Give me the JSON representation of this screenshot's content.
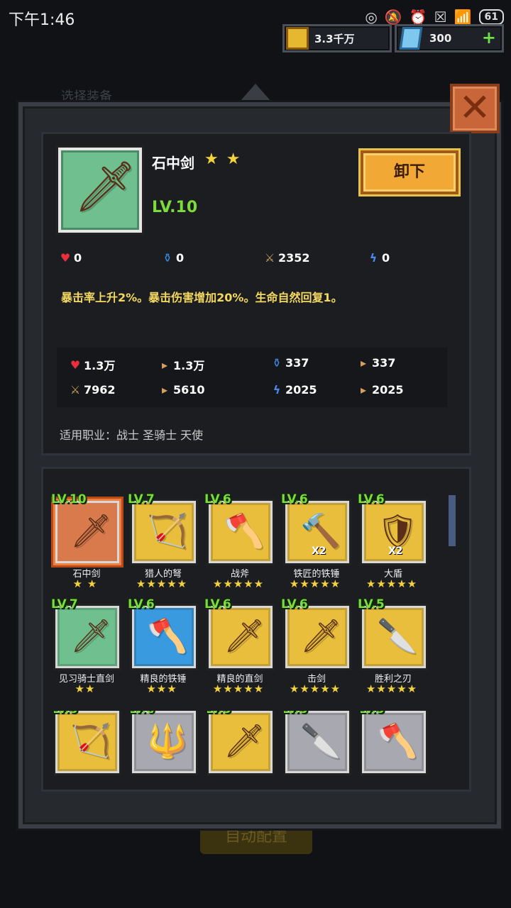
{
  "status": {
    "time": "下午1:46",
    "battery": "61"
  },
  "currency": {
    "gold": "3.3千万",
    "gems": "300",
    "add_label": "+"
  },
  "background": {
    "title": "选择装备",
    "button": "自动配置"
  },
  "close_label": "✕",
  "item": {
    "name": "石中剑",
    "stars": "★ ★",
    "level": "LV.10",
    "unequip_label": "卸下",
    "bonus": {
      "hp": "0",
      "mp": "0",
      "atk": "2352",
      "spd": "0"
    },
    "description": "暴击率上升2%。暴击伤害增加20%。生命自然回复1。",
    "totals": {
      "hp": "1.3万",
      "hp_next": "1.3万",
      "mp": "337",
      "mp_next": "337",
      "atk": "7962",
      "atk_next": "5610",
      "spd": "2025",
      "spd_next": "2025"
    },
    "jobs": "适用职业：战士 圣骑士 天使"
  },
  "inventory": [
    {
      "level": "LV.10",
      "name": "石中剑",
      "stars": "★ ★",
      "color": "orange",
      "icon": "sword-icon",
      "glyph": "🗡",
      "mult": ""
    },
    {
      "level": "LV.7",
      "name": "猎人的弩",
      "stars": "★★★★★",
      "color": "yellow",
      "icon": "crossbow-icon",
      "glyph": "🏹",
      "mult": ""
    },
    {
      "level": "LV.6",
      "name": "战斧",
      "stars": "★★★★★",
      "color": "yellow",
      "icon": "axe-icon",
      "glyph": "🪓",
      "mult": ""
    },
    {
      "level": "LV.6",
      "name": "铁匠的铁锤",
      "stars": "★★★★★",
      "color": "yellow",
      "icon": "hammer-icon",
      "glyph": "🔨",
      "mult": "X2"
    },
    {
      "level": "LV.6",
      "name": "大盾",
      "stars": "★★★★★",
      "color": "yellow",
      "icon": "shield-icon",
      "glyph": "🛡",
      "mult": "X2"
    },
    {
      "level": "LV.7",
      "name": "见习骑士直剑",
      "stars": "★★",
      "color": "green",
      "icon": "sword-icon",
      "glyph": "🗡",
      "mult": ""
    },
    {
      "level": "LV.6",
      "name": "精良的铁锤",
      "stars": "★★★",
      "color": "blue",
      "icon": "axe-icon",
      "glyph": "🪓",
      "mult": ""
    },
    {
      "level": "LV.6",
      "name": "精良的直剑",
      "stars": "★★★★★",
      "color": "yellow",
      "icon": "sword-icon",
      "glyph": "🗡",
      "mult": ""
    },
    {
      "level": "LV.6",
      "name": "击剑",
      "stars": "★★★★★",
      "color": "yellow",
      "icon": "rapier-icon",
      "glyph": "🗡",
      "mult": ""
    },
    {
      "level": "LV.5",
      "name": "胜利之刃",
      "stars": "★★★★★",
      "color": "yellow",
      "icon": "blade-icon",
      "glyph": "🔪",
      "mult": ""
    },
    {
      "level": "LV.5",
      "name": "",
      "stars": "",
      "color": "yellow",
      "icon": "crossbow-icon",
      "glyph": "🏹",
      "mult": ""
    },
    {
      "level": "LV.6",
      "name": "",
      "stars": "",
      "color": "gray",
      "icon": "trident-icon",
      "glyph": "🔱",
      "mult": ""
    },
    {
      "level": "LV.5",
      "name": "",
      "stars": "",
      "color": "yellow",
      "icon": "sword-icon",
      "glyph": "🗡",
      "mult": ""
    },
    {
      "level": "LV.5",
      "name": "",
      "stars": "",
      "color": "gray",
      "icon": "blade-icon",
      "glyph": "🔪",
      "mult": ""
    },
    {
      "level": "LV.5",
      "name": "",
      "stars": "",
      "color": "gray",
      "icon": "axe-icon",
      "glyph": "🪓",
      "mult": ""
    }
  ]
}
